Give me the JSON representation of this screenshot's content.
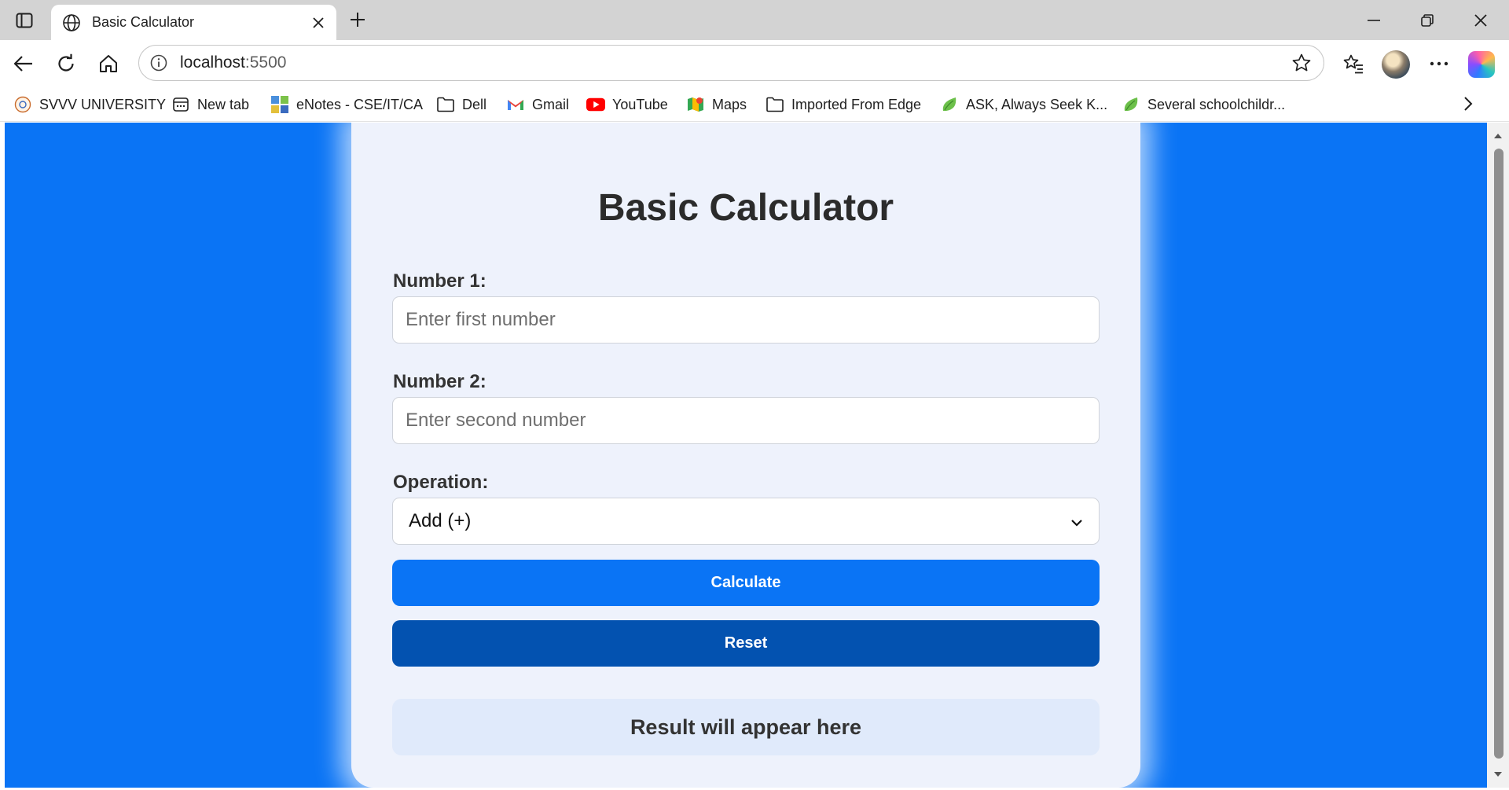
{
  "browser": {
    "tab_title": "Basic Calculator",
    "url_host": "localhost",
    "url_port": ":5500",
    "bookmarks": [
      "SVVV UNIVERSITY",
      "New tab",
      "eNotes - CSE/IT/CA",
      "Dell",
      "Gmail",
      "YouTube",
      "Maps",
      "Imported From Edge",
      "ASK, Always Seek K...",
      "Several schoolchildr..."
    ]
  },
  "page": {
    "title": "Basic Calculator",
    "number1_label": "Number 1:",
    "number1_placeholder": "Enter first number",
    "number1_value": "",
    "number2_label": "Number 2:",
    "number2_placeholder": "Enter second number",
    "number2_value": "",
    "operation_label": "Operation:",
    "operation_selected": "Add (+)",
    "calculate_label": "Calculate",
    "reset_label": "Reset",
    "result_text": "Result will appear here"
  },
  "colors": {
    "page_background": "#0a74f5",
    "card_background": "#eef2fc",
    "calculate_button": "#0a74f5",
    "reset_button": "#0352b0",
    "result_box": "#e0eafb"
  },
  "icons": {
    "tab_actions": "tab-actions-icon",
    "tab_favicon": "globe-icon",
    "tab_close": "close-icon",
    "new_tab": "plus-icon",
    "back": "back-arrow-icon",
    "reload": "reload-icon",
    "home": "home-icon",
    "site_info": "info-icon",
    "favorite": "star-icon",
    "favorites": "favorites-icon",
    "profile": "avatar",
    "more": "more-icon",
    "copilot": "copilot-icon"
  }
}
